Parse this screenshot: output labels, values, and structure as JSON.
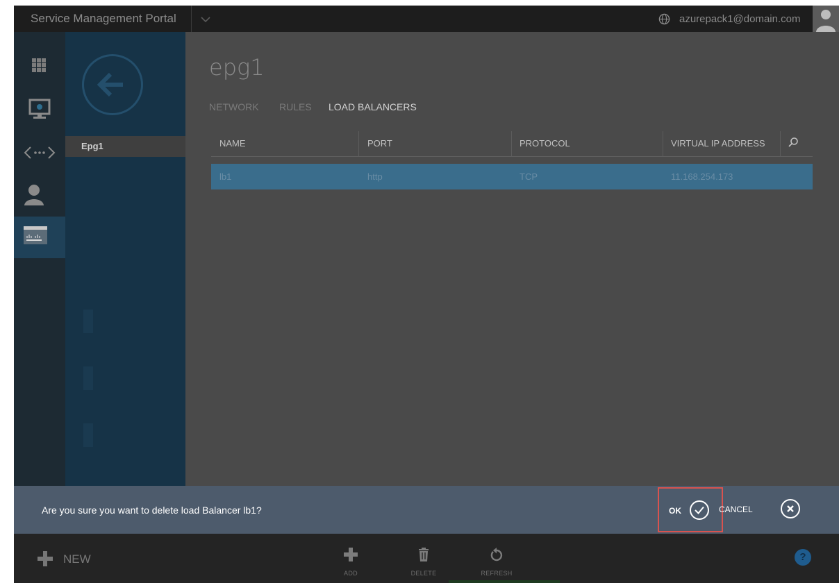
{
  "app": {
    "portal_title": "Service Management Portal",
    "user_email": "azurepack1@domain.com"
  },
  "panel": {
    "items": [
      {
        "label": "Epg1"
      }
    ]
  },
  "main": {
    "title": "epg1",
    "tabs": [
      {
        "label": "NETWORK",
        "active": false
      },
      {
        "label": "RULES",
        "active": false
      },
      {
        "label": "LOAD BALANCERS",
        "active": true
      }
    ],
    "columns": [
      "NAME",
      "PORT",
      "PROTOCOL",
      "VIRTUAL IP ADDRESS"
    ],
    "rows": [
      {
        "name": "lb1",
        "port": "http",
        "protocol": "TCP",
        "vip": "11.168.254.173"
      }
    ]
  },
  "confirm": {
    "message": "Are you sure you want to delete load Balancer lb1?",
    "ok_label": "OK",
    "cancel_label": "CANCEL"
  },
  "commandbar": {
    "new_label": "NEW",
    "add_label": "ADD",
    "delete_label": "DELETE",
    "refresh_label": "REFRESH",
    "help_label": "?"
  },
  "colors": {
    "accent": "#3a6d8c",
    "ok_highlight": "#d9534f",
    "confirm_bar": "#4d5b6c"
  }
}
